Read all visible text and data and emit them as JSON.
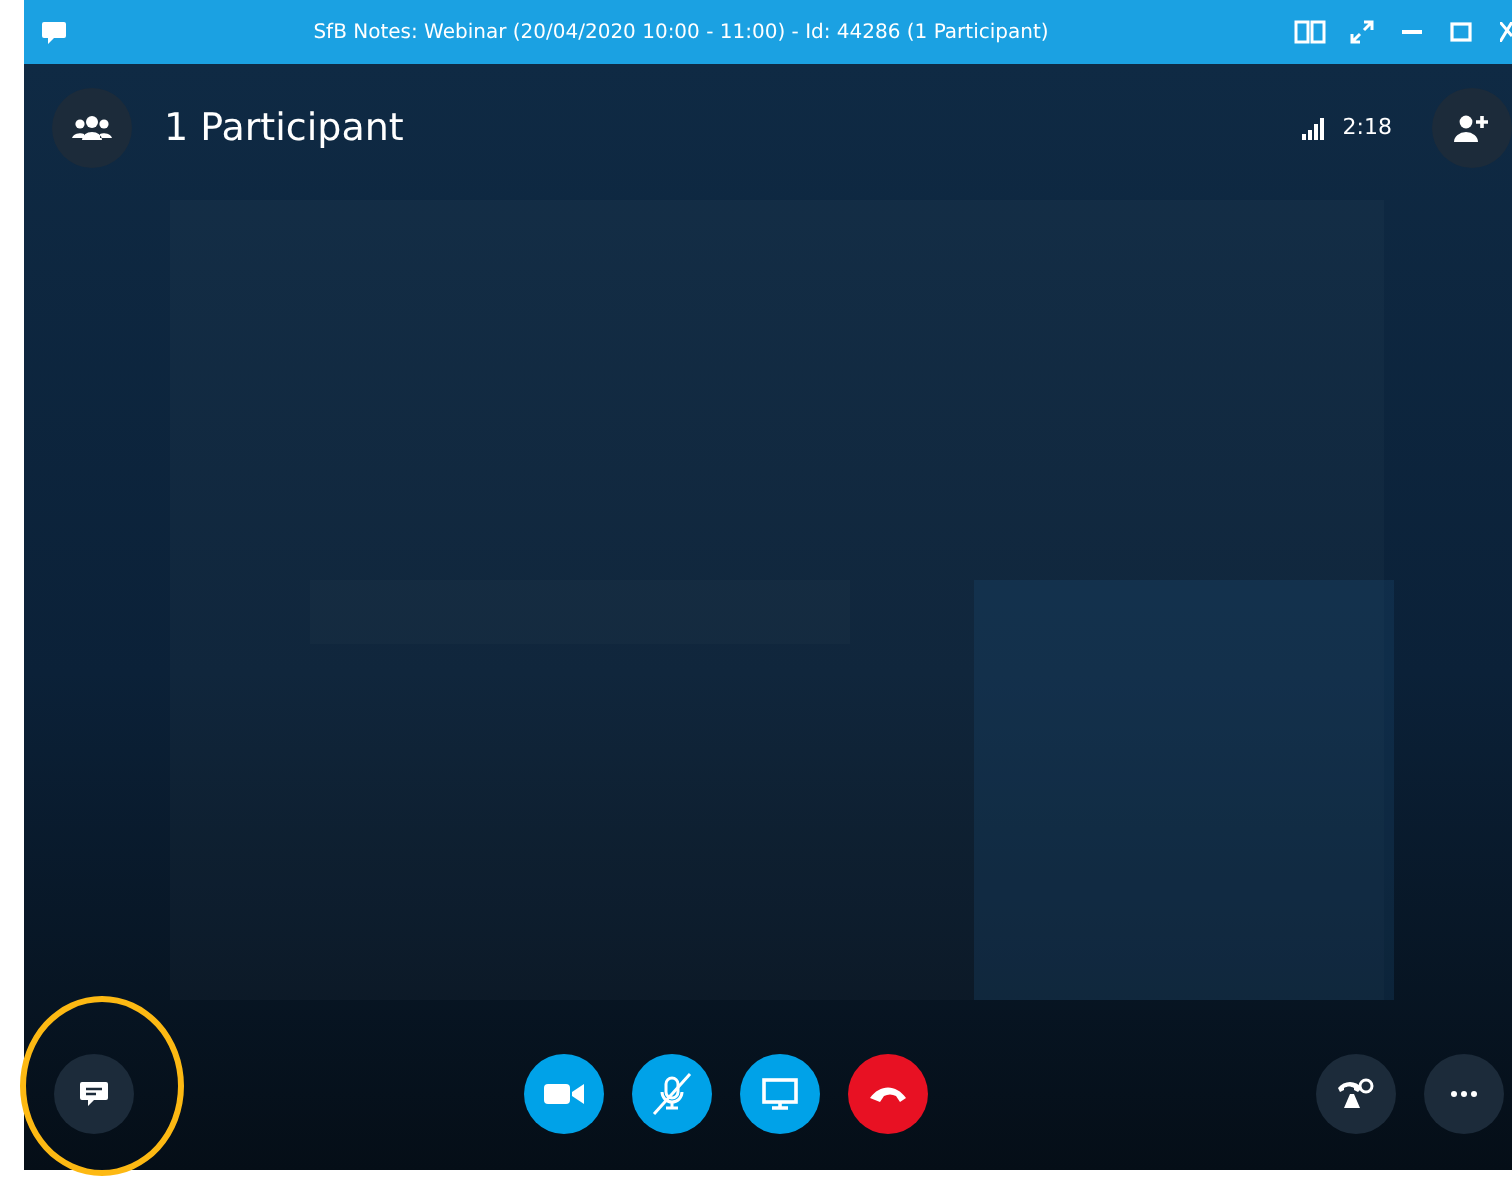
{
  "window": {
    "title": "SfB Notes: Webinar (20/04/2020 10:00 -  11:00) - Id: 44286 (1 Participant)"
  },
  "header": {
    "participants": "1 Participant",
    "call_time": "2:18"
  },
  "controls": [
    {
      "kind": "video",
      "on": true
    },
    {
      "kind": "mic",
      "muted": true
    },
    {
      "kind": "share"
    },
    {
      "kind": "hangup"
    }
  ],
  "chat": {
    "highlighted": true
  }
}
